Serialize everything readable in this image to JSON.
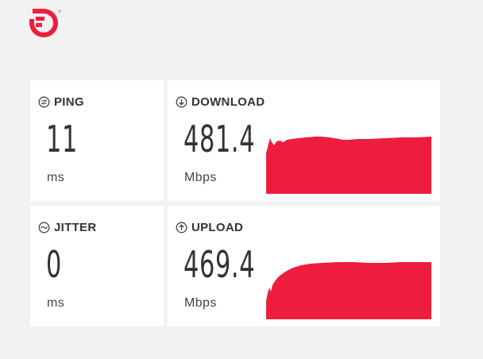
{
  "brand": {
    "logo_icon": "frontier-logo-icon",
    "accent_color": "#ee1d3e"
  },
  "ping": {
    "label": "PING",
    "value": "11",
    "unit": "ms",
    "icon": "ping-icon"
  },
  "jitter": {
    "label": "JITTER",
    "value": "0",
    "unit": "ms",
    "icon": "jitter-icon"
  },
  "download": {
    "label": "DOWNLOAD",
    "value": "481.4",
    "unit": "Mbps",
    "icon": "arrow-down-circle-icon"
  },
  "upload": {
    "label": "UPLOAD",
    "value": "469.4",
    "unit": "Mbps",
    "icon": "arrow-up-circle-icon"
  }
}
